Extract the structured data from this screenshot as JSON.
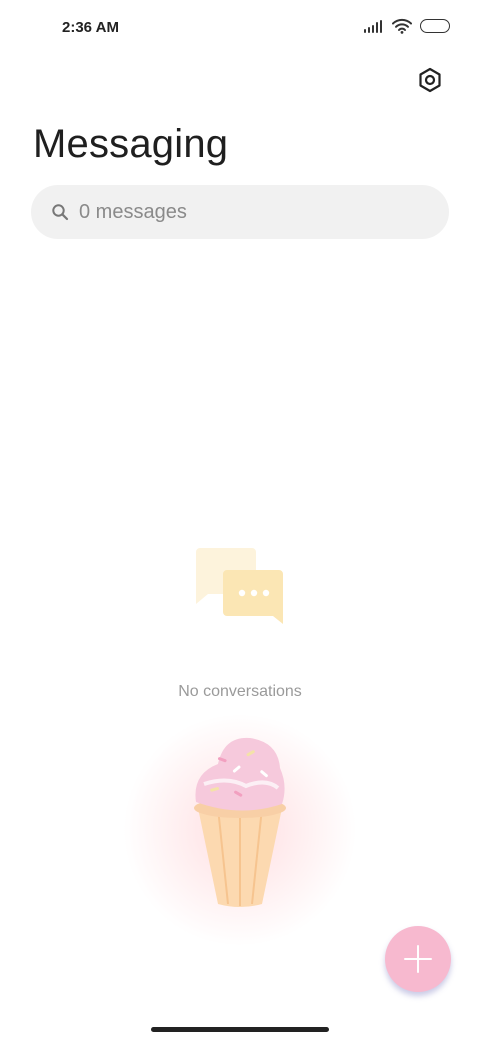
{
  "status_bar": {
    "time": "2:36 AM"
  },
  "header": {
    "title": "Messaging",
    "settings_icon": "settings-hexagon-icon"
  },
  "search": {
    "placeholder": "0 messages",
    "icon": "search-icon"
  },
  "empty_state": {
    "message": "No conversations",
    "icon": "chat-bubbles-icon"
  },
  "fab": {
    "icon": "plus-icon",
    "color": "#f7b9cf"
  },
  "colors": {
    "background": "#ffffff",
    "search_background": "#f1f1f1",
    "chat_icon": "#fbe6b4"
  }
}
